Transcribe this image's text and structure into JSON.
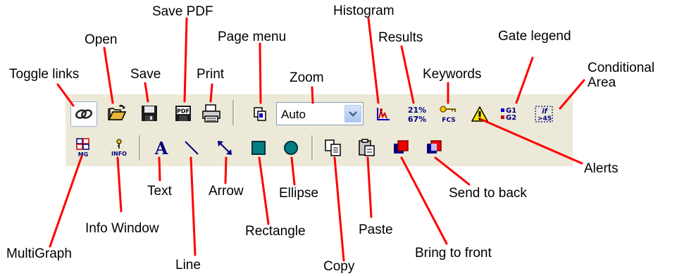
{
  "zoom": {
    "value": "Auto"
  },
  "icons": {
    "pdf_label": "PDF",
    "multigraph_label": "MG",
    "info_label": "INFO",
    "results_top": "21%",
    "results_bottom": "67%",
    "keywords_label": "FCS",
    "gate_g1": "G1",
    "gate_g2": "G2",
    "conditional_top": "if",
    "conditional_bottom": ">45",
    "text_glyph": "A"
  },
  "callouts": {
    "toggle_links": "Toggle links",
    "open": "Open",
    "save": "Save",
    "save_pdf": "Save PDF",
    "print": "Print",
    "page_menu": "Page menu",
    "zoom": "Zoom",
    "histogram": "Histogram",
    "results": "Results",
    "keywords": "Keywords",
    "gate_legend": "Gate legend",
    "conditional_area_1": "Conditional",
    "conditional_area_2": "Area",
    "alerts": "Alerts",
    "multigraph": "MultiGraph",
    "info_window": "Info Window",
    "text": "Text",
    "line": "Line",
    "arrow": "Arrow",
    "rectangle": "Rectangle",
    "ellipse": "Ellipse",
    "copy": "Copy",
    "paste": "Paste",
    "bring_to_front": "Bring to front",
    "send_to_back": "Send to back"
  },
  "colors": {
    "leader": "#ff0000",
    "toolbar": "#ece9d8",
    "accent_blue": "#0000cc"
  }
}
